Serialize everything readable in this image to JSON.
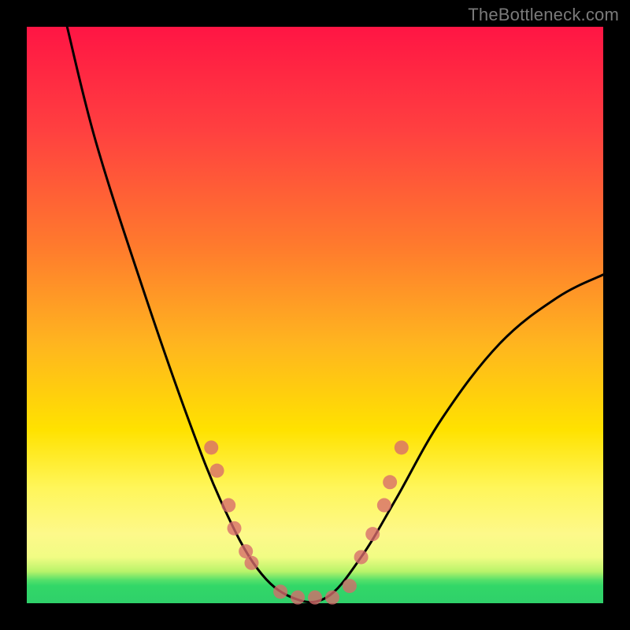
{
  "watermark": "TheBottleneck.com",
  "chart_data": {
    "type": "line",
    "title": "",
    "xlabel": "",
    "ylabel": "",
    "xlim": [
      0,
      100
    ],
    "ylim": [
      0,
      100
    ],
    "grid": false,
    "legend": false,
    "curve": {
      "name": "bottleneck-curve",
      "points": [
        {
          "x": 7,
          "y": 100
        },
        {
          "x": 12,
          "y": 80
        },
        {
          "x": 20,
          "y": 55
        },
        {
          "x": 28,
          "y": 32
        },
        {
          "x": 34,
          "y": 17
        },
        {
          "x": 40,
          "y": 6
        },
        {
          "x": 46,
          "y": 1
        },
        {
          "x": 52,
          "y": 1
        },
        {
          "x": 58,
          "y": 8
        },
        {
          "x": 64,
          "y": 18
        },
        {
          "x": 72,
          "y": 32
        },
        {
          "x": 82,
          "y": 45
        },
        {
          "x": 92,
          "y": 53
        },
        {
          "x": 100,
          "y": 57
        }
      ]
    },
    "markers": [
      {
        "x": 32,
        "y": 27
      },
      {
        "x": 33,
        "y": 23
      },
      {
        "x": 35,
        "y": 17
      },
      {
        "x": 36,
        "y": 13
      },
      {
        "x": 38,
        "y": 9
      },
      {
        "x": 39,
        "y": 7
      },
      {
        "x": 44,
        "y": 2
      },
      {
        "x": 47,
        "y": 1
      },
      {
        "x": 50,
        "y": 1
      },
      {
        "x": 53,
        "y": 1
      },
      {
        "x": 56,
        "y": 3
      },
      {
        "x": 58,
        "y": 8
      },
      {
        "x": 60,
        "y": 12
      },
      {
        "x": 62,
        "y": 17
      },
      {
        "x": 63,
        "y": 21
      },
      {
        "x": 65,
        "y": 27
      }
    ]
  },
  "colors": {
    "frame": "#000000",
    "curve": "#000000",
    "marker": "#d76a6b",
    "watermark": "#7a7a7a"
  }
}
